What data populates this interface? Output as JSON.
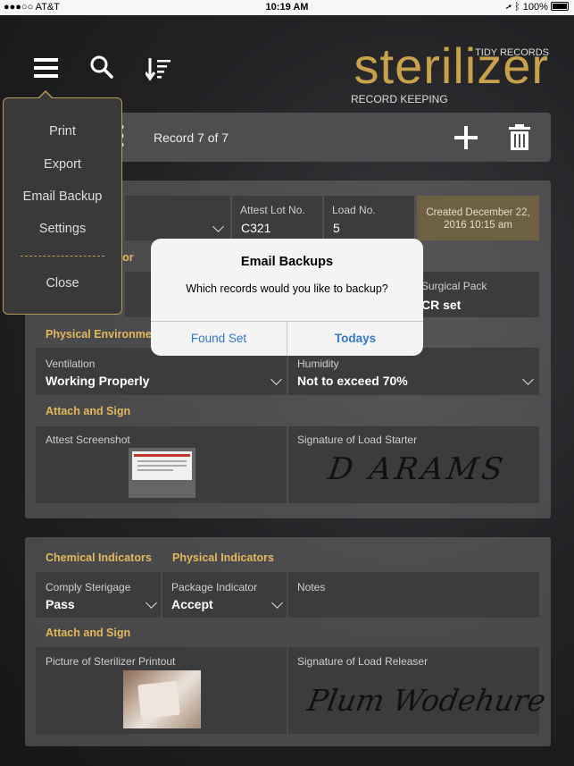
{
  "status": {
    "carrier": "●●●○○ AT&T",
    "time": "10:19 AM",
    "battery": "100%"
  },
  "logo": {
    "main": "sterilizer",
    "top": "TIDY RECORDS",
    "sub": "RECORD KEEPING"
  },
  "record_bar": {
    "text": "Record 7 of 7"
  },
  "load": {
    "attest_lot_label": "Attest Lot No.",
    "attest_lot_value": "C321",
    "load_no_label": "Load No.",
    "load_no_value": "5",
    "created": "Created December 22, 2016 10:15 am"
  },
  "bio_section": "ator",
  "surgical_pack_label": "Surgical Pack",
  "surgical_pack_value": "CR set",
  "physical_env": {
    "title": "Physical Environment",
    "ventilation_label": "Ventilation",
    "ventilation_value": "Working Properly",
    "humidity_label": "Humidity",
    "humidity_value": "Not to exceed  70%"
  },
  "attach_sign_1": {
    "title": "Attach and Sign",
    "screenshot_label": "Attest Screenshot",
    "signature_label": "Signature of Load Starter",
    "signature_text": "D ARAMS"
  },
  "release": {
    "chem_title": "Chemical Indicators",
    "phys_title": "Physical Indicators",
    "comply_label": "Comply Sterigage",
    "comply_value": "Pass",
    "package_label": "Package Indicator",
    "package_value": "Accept",
    "notes_label": "Notes"
  },
  "attach_sign_2": {
    "title": "Attach and Sign",
    "printout_label": "Picture of Sterilizer Printout",
    "signature_label": "Signature of Load Releaser",
    "signature_text": "Plum Wodehure"
  },
  "menu": {
    "items": [
      "Print",
      "Export",
      "Email Backup",
      "Settings"
    ],
    "close": "Close"
  },
  "dialog": {
    "title": "Email Backups",
    "message": "Which records would you like to backup?",
    "button_left": "Found Set",
    "button_right": "Todays"
  },
  "colors": {
    "accent": "#c8a24a",
    "section": "#e3b85a",
    "link": "#3478c8"
  }
}
